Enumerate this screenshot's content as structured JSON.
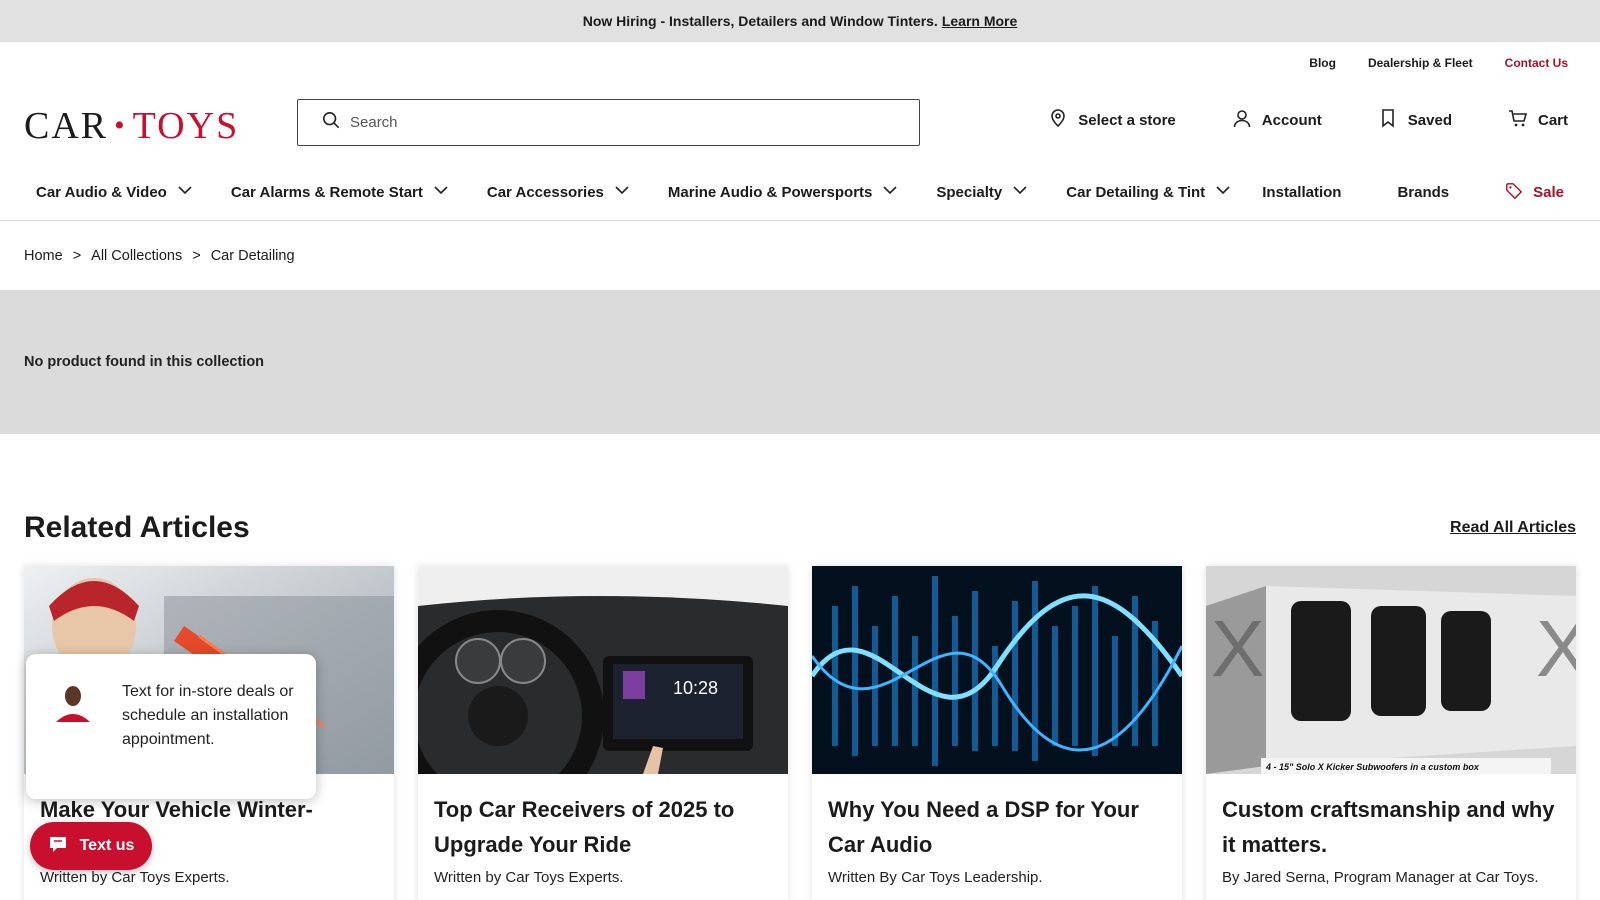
{
  "announcement": {
    "text": "Now Hiring - Installers, Detailers and Window Tinters.",
    "link": "Learn More"
  },
  "utility_nav": {
    "blog": "Blog",
    "dealership": "Dealership & Fleet",
    "contact": "Contact Us"
  },
  "logo": {
    "left": "CAR",
    "right": "TOYS"
  },
  "search": {
    "placeholder": "Search"
  },
  "header_actions": {
    "store": "Select a store",
    "account": "Account",
    "saved": "Saved",
    "cart": "Cart"
  },
  "main_nav": {
    "items": [
      "Car Audio & Video",
      "Car Alarms & Remote Start",
      "Car Accessories",
      "Marine Audio & Powersports",
      "Specialty",
      "Car Detailing & Tint"
    ],
    "installation": "Installation",
    "brands": "Brands",
    "sale": "Sale"
  },
  "breadcrumb": {
    "home": "Home",
    "collections": "All Collections",
    "current": "Car Detailing",
    "sep": ">"
  },
  "empty_state": "No product found in this collection",
  "related": {
    "heading": "Related Articles",
    "read_all": "Read All Articles",
    "articles": [
      {
        "title": "Make Your Vehicle Winter-Ready",
        "byline": "Written by Car Toys Experts."
      },
      {
        "title": "Top Car Receivers of 2025 to Upgrade Your Ride",
        "byline": "Written by Car Toys Experts."
      },
      {
        "title": "Why You Need a DSP for Your Car Audio",
        "byline": "Written By Car Toys Leadership."
      },
      {
        "title": "Custom craftsmanship and why it matters.",
        "byline": "By Jared Serna, Program Manager at Car Toys."
      }
    ],
    "receiver_time": "10:28",
    "sub_caption": "4 - 15\" Solo X Kicker Subwoofers in a custom box"
  },
  "chat_widget": {
    "message": "Text for in-store deals or schedule an installation appointment.",
    "button": "Text us"
  },
  "colors": {
    "brand_red": "#c8102e",
    "announce_bg": "#e1e1e1",
    "empty_bg": "#dbdbdb"
  }
}
